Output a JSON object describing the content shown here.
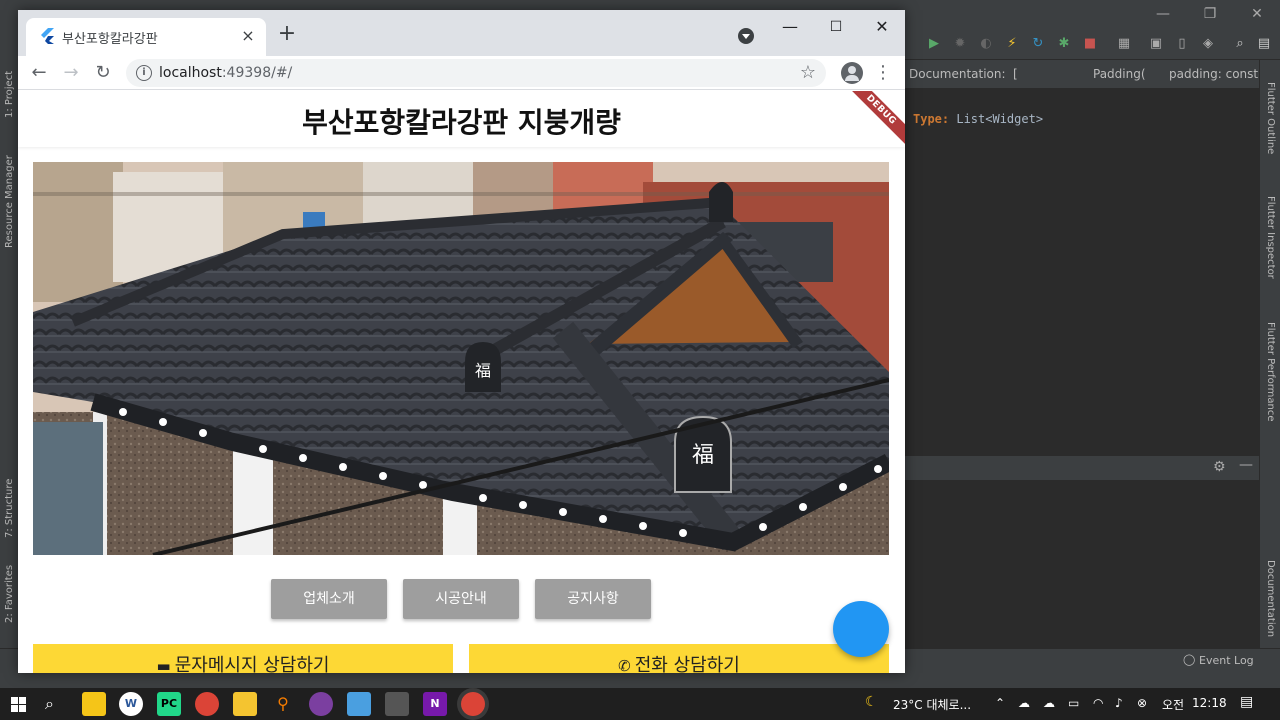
{
  "ide": {
    "documentation_label": "Documentation:",
    "doc_bracket": "[",
    "doc_widget": "Padding(",
    "doc_param": "padding: const E",
    "code_type_label": "Type:",
    "code_type_value": "List<Widget>",
    "left_tabs": [
      "1: Project",
      "Resource Manager",
      "7: Structure",
      "2: Favorites"
    ],
    "right_tabs": [
      "Flutter Outline",
      "Flutter Inspector",
      "Flutter Performance",
      "Documentation"
    ],
    "event_log": "Event Log"
  },
  "browser": {
    "tab_title": "부산포항칼라강판",
    "url_host": "localhost",
    "url_rest": ":49398/#/"
  },
  "app": {
    "title": "부산포항칼라강판 지붕개량",
    "debug_banner": "DEBUG",
    "menu": [
      "업체소개",
      "시공안내",
      "공지사항"
    ],
    "sms_button": "문자메시지 상담하기",
    "call_button": "전화 상담하기"
  },
  "taskbar": {
    "weather": "23°C  대체로...",
    "ime": "오전",
    "time": "12:18"
  },
  "colors": {
    "fab": "#2196f3",
    "consult": "#fdd835",
    "menu_button": "#9e9e9e",
    "debug": "#b13b3b"
  }
}
